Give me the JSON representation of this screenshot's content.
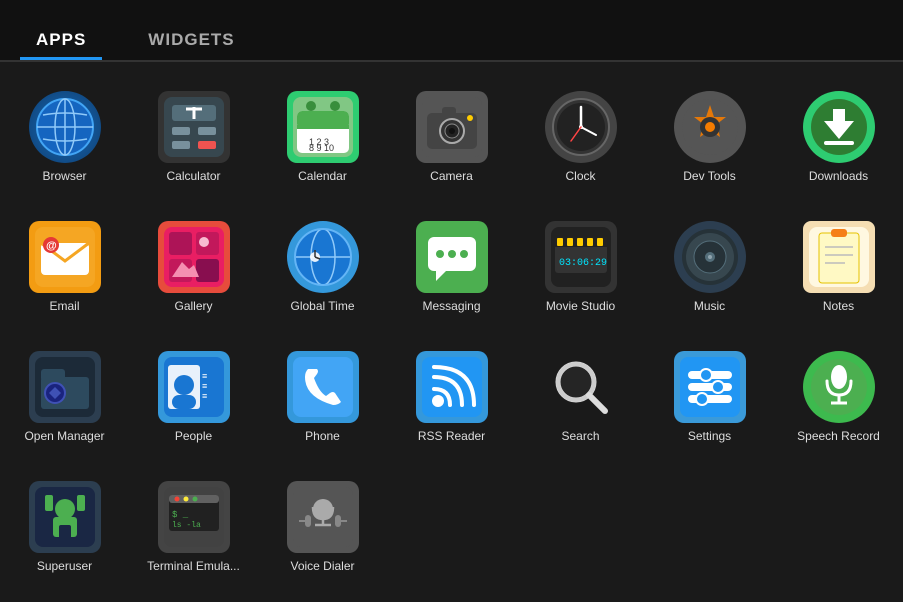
{
  "header": {
    "tabs": [
      {
        "id": "apps",
        "label": "APPS",
        "active": true
      },
      {
        "id": "widgets",
        "label": "WIDGETS",
        "active": false
      }
    ]
  },
  "apps": [
    {
      "id": "browser",
      "label": "Browser",
      "iconClass": "icon-browser",
      "iconSymbol": "🌐"
    },
    {
      "id": "calculator",
      "label": "Calculator",
      "iconClass": "icon-calculator",
      "iconSymbol": "🧮"
    },
    {
      "id": "calendar",
      "label": "Calendar",
      "iconClass": "icon-calendar",
      "iconSymbol": "📅"
    },
    {
      "id": "camera",
      "label": "Camera",
      "iconClass": "icon-camera",
      "iconSymbol": "📷"
    },
    {
      "id": "clock",
      "label": "Clock",
      "iconClass": "icon-clock",
      "iconSymbol": "🕐"
    },
    {
      "id": "devtools",
      "label": "Dev Tools",
      "iconClass": "icon-devtools",
      "iconSymbol": "⚙️"
    },
    {
      "id": "downloads",
      "label": "Downloads",
      "iconClass": "icon-downloads",
      "iconSymbol": "⬇️"
    },
    {
      "id": "email",
      "label": "Email",
      "iconClass": "icon-email",
      "iconSymbol": "✉️"
    },
    {
      "id": "gallery",
      "label": "Gallery",
      "iconClass": "icon-gallery",
      "iconSymbol": "🖼️"
    },
    {
      "id": "globaltime",
      "label": "Global Time",
      "iconClass": "icon-globaltime",
      "iconSymbol": "🌍"
    },
    {
      "id": "messaging",
      "label": "Messaging",
      "iconClass": "icon-messaging",
      "iconSymbol": "💬"
    },
    {
      "id": "moviestudio",
      "label": "Movie Studio",
      "iconClass": "icon-moviestudio",
      "iconSymbol": "🎬"
    },
    {
      "id": "music",
      "label": "Music",
      "iconClass": "icon-music",
      "iconSymbol": "🎵"
    },
    {
      "id": "notes",
      "label": "Notes",
      "iconClass": "icon-notes",
      "iconSymbol": "📝"
    },
    {
      "id": "openmanager",
      "label": "Open Manager",
      "iconClass": "icon-openmanager",
      "iconSymbol": "📁"
    },
    {
      "id": "people",
      "label": "People",
      "iconClass": "icon-people",
      "iconSymbol": "👤"
    },
    {
      "id": "phone",
      "label": "Phone",
      "iconClass": "icon-phone",
      "iconSymbol": "📞"
    },
    {
      "id": "rssreader",
      "label": "RSS Reader",
      "iconClass": "icon-rssreader",
      "iconSymbol": "📡"
    },
    {
      "id": "search",
      "label": "Search",
      "iconClass": "icon-search",
      "iconSymbol": "🔍"
    },
    {
      "id": "settings",
      "label": "Settings",
      "iconClass": "icon-settings",
      "iconSymbol": "⚙️"
    },
    {
      "id": "speechrecord",
      "label": "Speech Record",
      "iconClass": "icon-speechrecord",
      "iconSymbol": "🤖"
    },
    {
      "id": "superuser",
      "label": "Superuser",
      "iconClass": "icon-superuser",
      "iconSymbol": "🤖"
    },
    {
      "id": "terminalemulator",
      "label": "Terminal Emula...",
      "iconClass": "icon-terminalemulator",
      "iconSymbol": "🖥️"
    },
    {
      "id": "voicedialer",
      "label": "Voice Dialer",
      "iconClass": "icon-voicedialer",
      "iconSymbol": "🎙️"
    }
  ],
  "colors": {
    "tabActive": "#ffffff",
    "tabInactive": "#aaaaaa",
    "tabUnderline": "#2196f3",
    "background": "#1a1a1a"
  }
}
